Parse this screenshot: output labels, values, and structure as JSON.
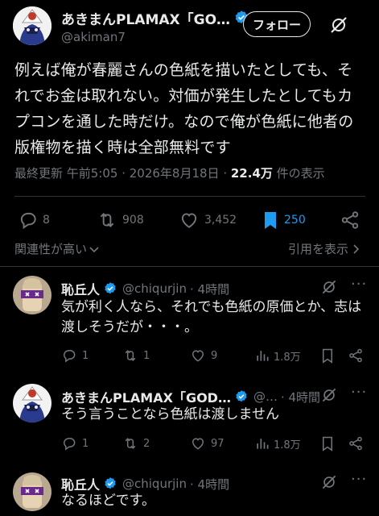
{
  "main_tweet": {
    "author_name": "あきまんPLAMAX「GO…",
    "author_handle": "@akiman7",
    "follow_label": "フォロー",
    "text_lines": [
      "例えば俺が春麗さんの色紙を描いたとしても、そ",
      "れでお金は取れない。対価が発生したとしてもカ",
      "プコンを通した時だけ。なので俺が色紙に他者の",
      "版権物を描く時は全部無料です"
    ],
    "timestamp_prefix": "最終更新 午前5:05 · 2026年8月18日 · ",
    "views_count": "22.4万",
    "views_suffix": " 件の表示",
    "replies": "8",
    "reposts": "908",
    "likes": "3,452",
    "bookmarks": "250",
    "sort_label": "関連性が高い",
    "quotes_label": "引用を表示"
  },
  "replies": [
    {
      "name": "恥丘人",
      "handle": "@chiqurjin",
      "time": "· 4時間",
      "text_lines": [
        "気が利く人なら、それでも色紙の原価とか、志は",
        "渡しそうだが・・・。"
      ],
      "reply_count": "1",
      "repost_count": "1",
      "like_count": "9",
      "view_count": "1.8万"
    },
    {
      "name": "あきまんPLAMAX「GOD…",
      "handle": "@…",
      "time": "· 4時間",
      "text_lines": [
        "そう言うことなら色紙は渡しません"
      ],
      "reply_count": "1",
      "repost_count": "2",
      "like_count": "97",
      "view_count": "1.8万"
    },
    {
      "name": "恥丘人",
      "handle": "@chiqurjin",
      "time": "· 4時間",
      "text_lines": [
        "なるほどです。"
      ]
    }
  ],
  "colors": {
    "background": "#000000",
    "text": "#e7e9ea",
    "secondary": "#71767b",
    "verified": "#1d9bf0",
    "bookmark_active": "#1d9bf0",
    "divider": "#2f3336"
  },
  "icons": [
    "verified-badge-icon",
    "grok-icon",
    "reply-icon",
    "repost-icon",
    "like-icon",
    "bookmark-icon",
    "share-icon",
    "views-icon",
    "chevron-down-icon",
    "chevron-right-icon"
  ]
}
